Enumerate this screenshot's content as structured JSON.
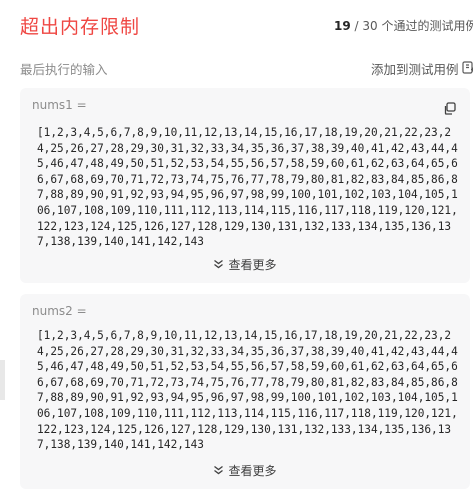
{
  "header": {
    "title": "超出内存限制",
    "passed_count": "19",
    "separator": " / ",
    "total_count": "30",
    "passed_suffix": " 个通过的测试用例"
  },
  "subheader": {
    "label": "最后执行的输入",
    "add_testcase": "添加到测试用例"
  },
  "inputs": [
    {
      "label": "nums1 =",
      "value": "[1,2,3,4,5,6,7,8,9,10,11,12,13,14,15,16,17,18,19,20,21,22,23,24,25,26,27,28,29,30,31,32,33,34,35,36,37,38,39,40,41,42,43,44,45,46,47,48,49,50,51,52,53,54,55,56,57,58,59,60,61,62,63,64,65,66,67,68,69,70,71,72,73,74,75,76,77,78,79,80,81,82,83,84,85,86,87,88,89,90,91,92,93,94,95,96,97,98,99,100,101,102,103,104,105,106,107,108,109,110,111,112,113,114,115,116,117,118,119,120,121,122,123,124,125,126,127,128,129,130,131,132,133,134,135,136,137,138,139,140,141,142,143",
      "more": "查看更多"
    },
    {
      "label": "nums2 =",
      "value": "[1,2,3,4,5,6,7,8,9,10,11,12,13,14,15,16,17,18,19,20,21,22,23,24,25,26,27,28,29,30,31,32,33,34,35,36,37,38,39,40,41,42,43,44,45,46,47,48,49,50,51,52,53,54,55,56,57,58,59,60,61,62,63,64,65,66,67,68,69,70,71,72,73,74,75,76,77,78,79,80,81,82,83,84,85,86,87,88,89,90,91,92,93,94,95,96,97,98,99,100,101,102,103,104,105,106,107,108,109,110,111,112,113,114,115,116,117,118,119,120,121,122,123,124,125,126,127,128,129,130,131,132,133,134,135,136,137,138,139,140,141,142,143",
      "more": "查看更多"
    }
  ],
  "colors": {
    "title": "#ef4743",
    "card_bg": "#f7f7f8"
  },
  "icons": {
    "copy": "copy-icon",
    "add": "add-testcase-icon",
    "expand": "chevron-double-down-icon"
  }
}
